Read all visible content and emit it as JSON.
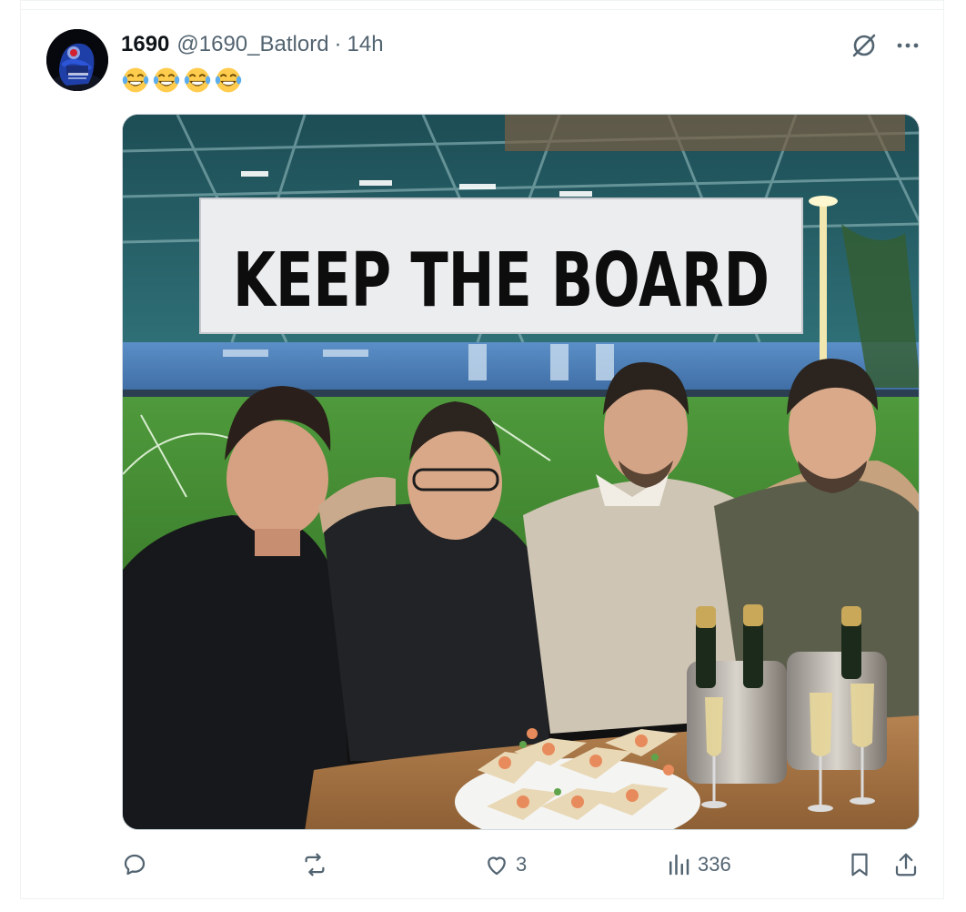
{
  "tweet": {
    "display_name": "1690",
    "handle": "@1690_Batlord",
    "separator": "·",
    "time": "14h",
    "text_emojis": [
      "face-with-tears-of-joy",
      "face-with-tears-of-joy",
      "face-with-tears-of-joy",
      "face-with-tears-of-joy"
    ]
  },
  "media": {
    "banner_text": "KEEP THE BOARD"
  },
  "actions": {
    "reply_count": "",
    "retweet_count": "",
    "like_count": "3",
    "views_count": "336"
  },
  "colors": {
    "text_primary": "#0f1419",
    "text_secondary": "#536471",
    "border": "#cfd9de",
    "divider": "#eff3f4"
  },
  "icons": {
    "reply": "reply-icon",
    "retweet": "retweet-icon",
    "like": "heart-icon",
    "views": "views-icon",
    "bookmark": "bookmark-icon",
    "share": "share-icon",
    "grok": "grok-icon",
    "more": "more-icon"
  }
}
